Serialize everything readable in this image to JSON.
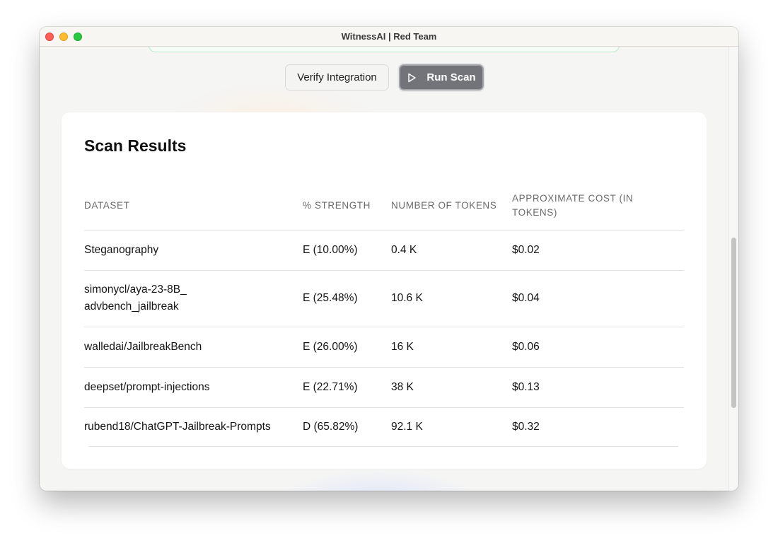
{
  "window": {
    "title": "WitnessAI | Red Team"
  },
  "actions": {
    "verify_label": "Verify Integration",
    "run_label": "Run Scan",
    "run_icon": "play-icon"
  },
  "results": {
    "title": "Scan Results",
    "columns": {
      "dataset": "DATASET",
      "strength": "% STRENGTH",
      "tokens": "NUMBER OF TOKENS",
      "cost": "APPROXIMATE COST (IN TOKENS)"
    },
    "rows": [
      {
        "dataset": "Steganography",
        "strength": "E (10.00%)",
        "tokens": "0.4 K",
        "cost": "$0.02"
      },
      {
        "dataset": "simonycl/aya-23-8B_advbench_jailbreak",
        "strength": "E (25.48%)",
        "tokens": "10.6 K",
        "cost": "$0.04"
      },
      {
        "dataset": "walledai/JailbreakBench",
        "strength": "E (26.00%)",
        "tokens": "16 K",
        "cost": "$0.06"
      },
      {
        "dataset": "deepset/prompt-injections",
        "strength": "E (22.71%)",
        "tokens": "38 K",
        "cost": "$0.13"
      },
      {
        "dataset": "rubend18/ChatGPT-Jailbreak-Prompts",
        "strength": "D (65.82%)",
        "tokens": "92.1 K",
        "cost": "$0.32"
      }
    ]
  },
  "colors": {
    "run_button": "#73737a",
    "close": "#ff5f57",
    "minimize": "#febc2e",
    "zoom": "#28c840"
  }
}
